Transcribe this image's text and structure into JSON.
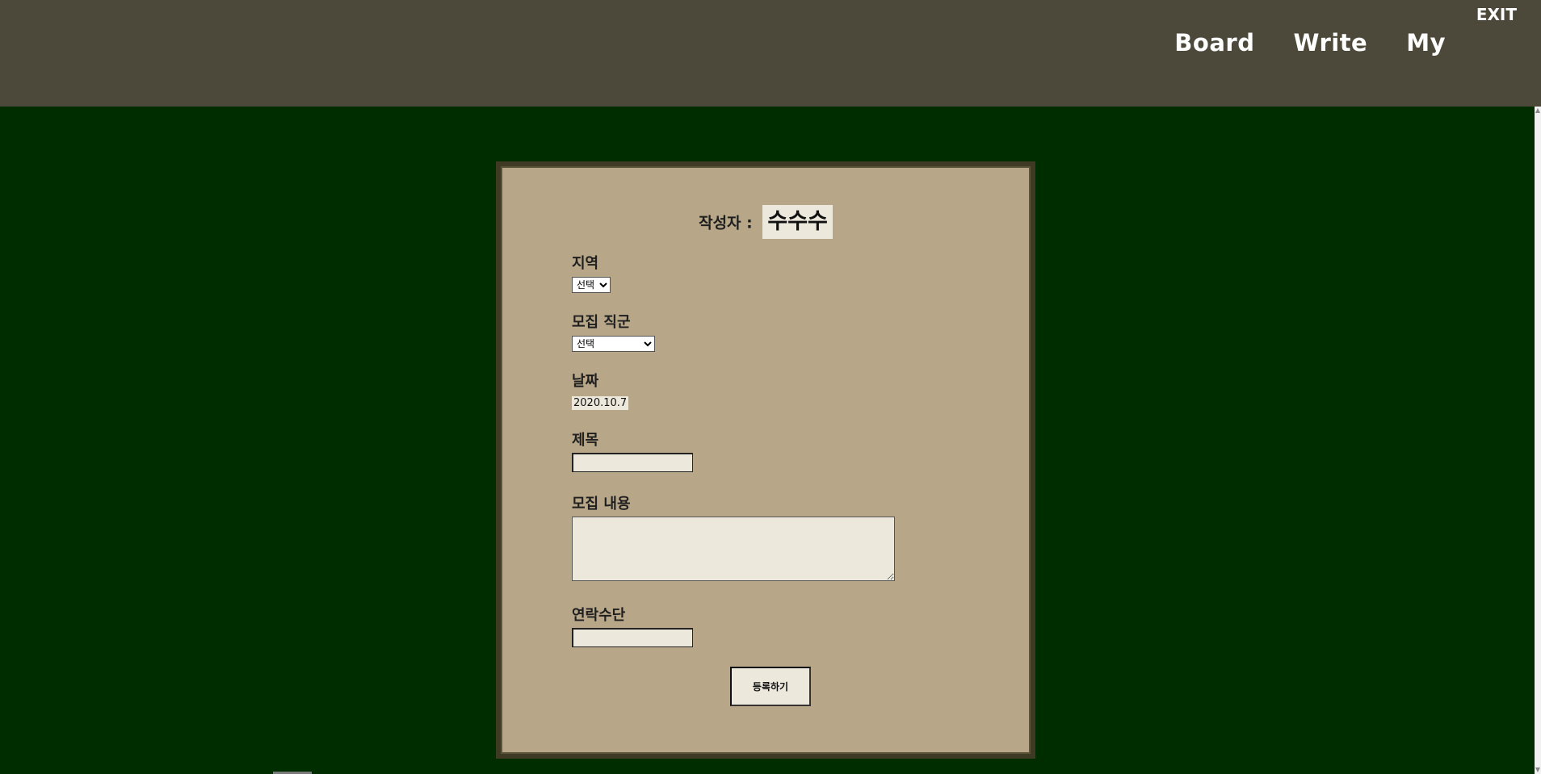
{
  "header": {
    "exit_label": "EXIT",
    "nav": {
      "board": "Board",
      "write": "Write",
      "my": "My"
    }
  },
  "form": {
    "author_label": "작성자 :",
    "author_name": "수수수",
    "region_label": "지역",
    "region_selected": "선택",
    "job_label": "모집 직군",
    "job_selected": "선택",
    "date_label": "날짜",
    "date_value": "2020.10.7",
    "title_label": "제목",
    "title_value": "",
    "content_label": "모집 내용",
    "content_value": "",
    "contact_label": "연락수단",
    "contact_value": "",
    "submit_label": "등록하기"
  },
  "colors": {
    "header_bg": "#4c483a",
    "page_bg": "#002d00",
    "panel_bg": "#b7a688",
    "panel_border": "#3f3a24",
    "input_bg": "#ece9dc"
  }
}
